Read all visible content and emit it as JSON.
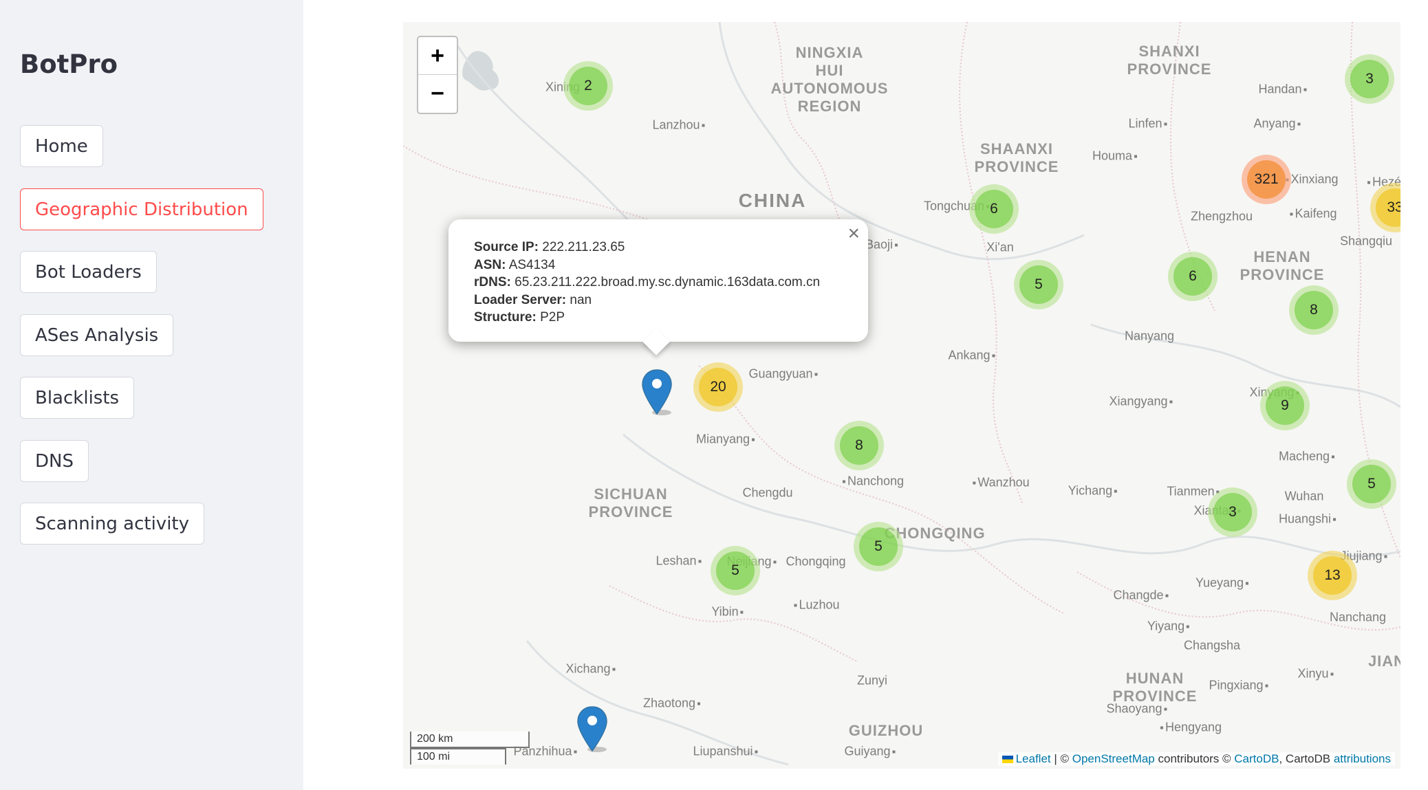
{
  "app": {
    "brand": "BotPro",
    "nav": [
      {
        "label": "Home",
        "active": false
      },
      {
        "label": "Geographic Distribution",
        "active": true
      },
      {
        "label": "Bot Loaders",
        "active": false
      },
      {
        "label": "ASes Analysis",
        "active": false
      },
      {
        "label": "Blacklists",
        "active": false
      },
      {
        "label": "DNS",
        "active": false
      },
      {
        "label": "Scanning activity",
        "active": false
      }
    ],
    "accent_color": "#ff4b4b"
  },
  "map": {
    "zoom_in": "+",
    "zoom_out": "−",
    "country_label": "CHINA",
    "regions": [
      [
        "NINGXIA",
        "HUI",
        "AUTONOMOUS",
        "REGION"
      ],
      [
        "SHANXI",
        "PROVINCE"
      ],
      [
        "SHAANXI",
        "PROVINCE"
      ],
      [
        "HENAN",
        "PROVINCE"
      ],
      [
        "SICHUAN",
        "PROVINCE"
      ],
      [
        "CHONGQING"
      ],
      [
        "HUNAN",
        "PROVINCE"
      ],
      [
        "GUIZHOU"
      ],
      [
        "JIAN"
      ]
    ],
    "cities": [
      "Xining",
      "Lanzhou",
      "Handan",
      "Linfen",
      "Anyang",
      "Houma",
      "Tongchuan",
      "Xinxiang",
      "Hezé",
      "Zhengzhou",
      "Kaifeng",
      "Baoji",
      "Xi'an",
      "Shangqiu",
      "Ankang",
      "Nanyang",
      "Guangyuan",
      "Xiangyang",
      "Xinyang",
      "Mianyang",
      "Chengdu",
      "Nanchong",
      "Wanzhou",
      "Yichang",
      "Tianmen",
      "Wuhan",
      "Macheng",
      "Xiantao",
      "Huangshi",
      "Leshan",
      "Neijiang",
      "Chongqing",
      "Jiujiang",
      "Yibin",
      "Luzhou",
      "Changde",
      "Yueyang",
      "Nanchang",
      "Yiyang",
      "Changsha",
      "Xinyu",
      "Xichang",
      "Zunyi",
      "Pingxiang",
      "Zhaotong",
      "Shaoyang",
      "Hengyang",
      "Panzhihua",
      "Liupanshui",
      "Guiyang"
    ],
    "clusters": [
      {
        "count": "2",
        "size": "small"
      },
      {
        "count": "3",
        "size": "small"
      },
      {
        "count": "321",
        "size": "large"
      },
      {
        "count": "6",
        "size": "small"
      },
      {
        "count": "33",
        "size": "medium"
      },
      {
        "count": "5",
        "size": "small"
      },
      {
        "count": "6",
        "size": "small"
      },
      {
        "count": "8",
        "size": "small"
      },
      {
        "count": "20",
        "size": "medium"
      },
      {
        "count": "9",
        "size": "small"
      },
      {
        "count": "8",
        "size": "small"
      },
      {
        "count": "5",
        "size": "small"
      },
      {
        "count": "3",
        "size": "small"
      },
      {
        "count": "5",
        "size": "small"
      },
      {
        "count": "5",
        "size": "small"
      },
      {
        "count": "13",
        "size": "medium"
      }
    ],
    "popup": {
      "source_ip_label": "Source IP:",
      "source_ip": "222.211.23.65",
      "asn_label": "ASN:",
      "asn": "AS4134",
      "rdns_label": "rDNS:",
      "rdns": "65.23.211.222.broad.my.sc.dynamic.163data.com.cn",
      "loader_label": "Loader Server:",
      "loader": "nan",
      "structure_label": "Structure:",
      "structure": "P2P",
      "close": "×"
    },
    "scale": {
      "km": "200 km",
      "mi": "100 mi"
    },
    "attribution": {
      "leaflet": "Leaflet",
      "sep": " | © ",
      "osm": "OpenStreetMap",
      "contrib": " contributors © ",
      "carto": "CartoDB",
      "tail": ", CartoDB ",
      "attributions": "attributions"
    },
    "marker_color": "#2a81cb"
  }
}
